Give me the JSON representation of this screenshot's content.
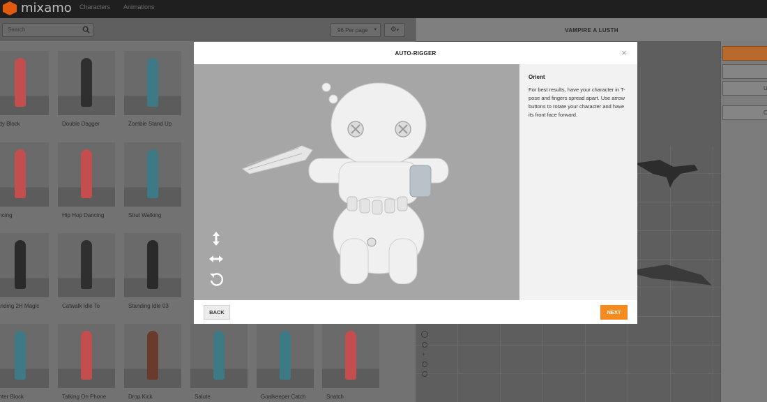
{
  "app": {
    "name": "mixamo"
  },
  "nav": {
    "characters": "Characters",
    "animations": "Animations"
  },
  "toolbar": {
    "search_placeholder": "Search",
    "per_page": "96 Per page"
  },
  "viewer": {
    "character_name": "VAMPIRE A LUSTH"
  },
  "animations": [
    {
      "label": "ody Block",
      "color": "#c44e4e"
    },
    {
      "label": "Double Dagger",
      "color": "#2f2f2f"
    },
    {
      "label": "Zombie Stand Up",
      "color": "#3d7a86"
    },
    {
      "label": "ancing",
      "color": "#c44e4e"
    },
    {
      "label": "Hip Hop Dancing",
      "color": "#c44e4e"
    },
    {
      "label": "Strut Walking",
      "color": "#3d7a86"
    },
    {
      "label": "tanding 2H Magic",
      "color": "#2a2a2a"
    },
    {
      "label": "Catwalk Idle To",
      "color": "#2f2f2f"
    },
    {
      "label": "Standing Idle 03",
      "color": "#2a2a2a"
    },
    {
      "label": "enter Block",
      "color": "#3d7a86"
    },
    {
      "label": "Talking On Phone",
      "color": "#c44e4e"
    },
    {
      "label": "Drop Kick",
      "color": "#6a3a2a"
    },
    {
      "label": "Salute",
      "color": "#3d7a86"
    },
    {
      "label": "Goalkeeper Catch",
      "color": "#3d7a86"
    },
    {
      "label": "Snatch",
      "color": "#c44e4e"
    }
  ],
  "sidebar": {
    "btn_u": "U",
    "btn_c": "C"
  },
  "modal": {
    "title": "AUTO-RIGGER",
    "close": "×",
    "info_title": "Orient",
    "info_body": "For best results, have your character in T-pose and fingers spread apart. Use arrow buttons to rotate your character and have its front face forward.",
    "back": "BACK",
    "next": "NEXT"
  },
  "colors": {
    "accent": "#f58a1f",
    "brand": "#e05a10"
  }
}
